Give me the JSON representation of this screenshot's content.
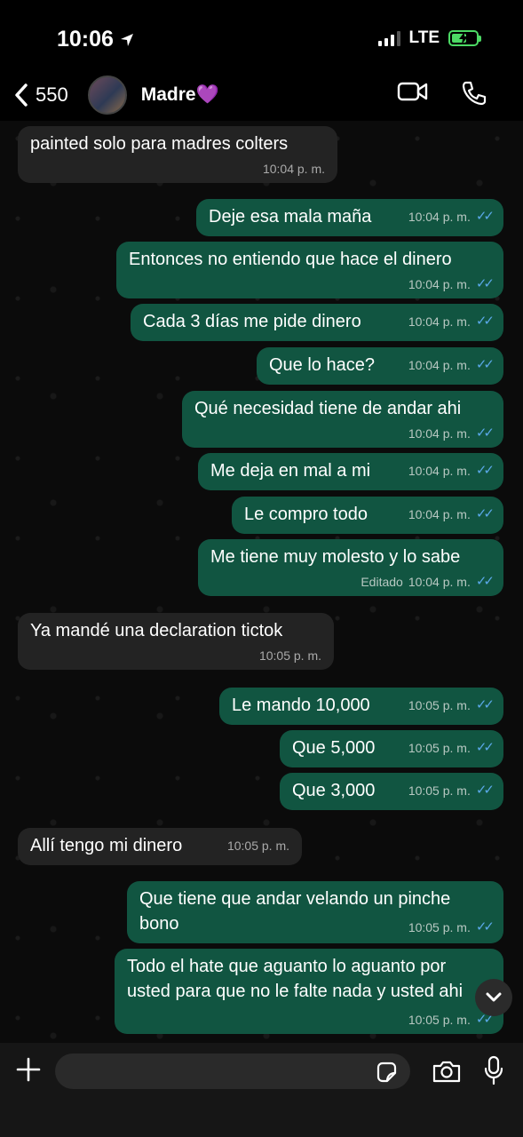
{
  "status": {
    "time": "10:06",
    "network": "LTE"
  },
  "header": {
    "back_count": "550",
    "contact": "Madre💜"
  },
  "messages": [
    {
      "dir": "in",
      "text": "painted solo para madres colters",
      "time": "10:04 p. m."
    },
    {
      "dir": "out",
      "text": "Deje esa mala maña",
      "time": "10:04 p. m."
    },
    {
      "dir": "out",
      "text": "Entonces no entiendo que hace el dinero",
      "time": "10:04 p. m."
    },
    {
      "dir": "out",
      "text": "Cada 3 días me pide dinero",
      "time": "10:04 p. m."
    },
    {
      "dir": "out",
      "text": "Que lo hace?",
      "time": "10:04 p. m."
    },
    {
      "dir": "out",
      "text": "Qué necesidad tiene de andar ahi",
      "time": "10:04 p. m."
    },
    {
      "dir": "out",
      "text": "Me deja en mal a mi",
      "time": "10:04 p. m."
    },
    {
      "dir": "out",
      "text": "Le compro todo",
      "time": "10:04 p. m."
    },
    {
      "dir": "out",
      "text": "Me tiene muy molesto y lo sabe",
      "time": "10:04 p. m.",
      "edited": "Editado"
    },
    {
      "dir": "in",
      "text": "Ya mandé  una declaration tictok",
      "time": "10:05 p. m."
    },
    {
      "dir": "out",
      "text": "Le mando 10,000",
      "time": "10:05 p. m."
    },
    {
      "dir": "out",
      "text": "Que 5,000",
      "time": "10:05 p. m."
    },
    {
      "dir": "out",
      "text": "Que 3,000",
      "time": "10:05 p. m."
    },
    {
      "dir": "in",
      "text": "Allí tengo mi dinero",
      "time": "10:05 p. m."
    },
    {
      "dir": "out",
      "text": "Que tiene que andar velando un pinche bono",
      "time": "10:05 p. m."
    },
    {
      "dir": "out",
      "text": "Todo el hate que aguanto lo aguanto por usted para que no le falte nada y usted ahi",
      "time": "10:05 p. m."
    }
  ],
  "icons": {
    "back": "chevron-left-icon",
    "video": "video-call-icon",
    "call": "phone-icon",
    "plus": "plus-icon",
    "sticker": "sticker-icon",
    "camera": "camera-icon",
    "mic": "microphone-icon",
    "scroll": "chevron-down-icon"
  },
  "colors": {
    "outgoing_bubble": "#115541",
    "incoming_bubble": "#232323",
    "read_ticks": "#5aa8e8",
    "battery": "#4cd964"
  }
}
